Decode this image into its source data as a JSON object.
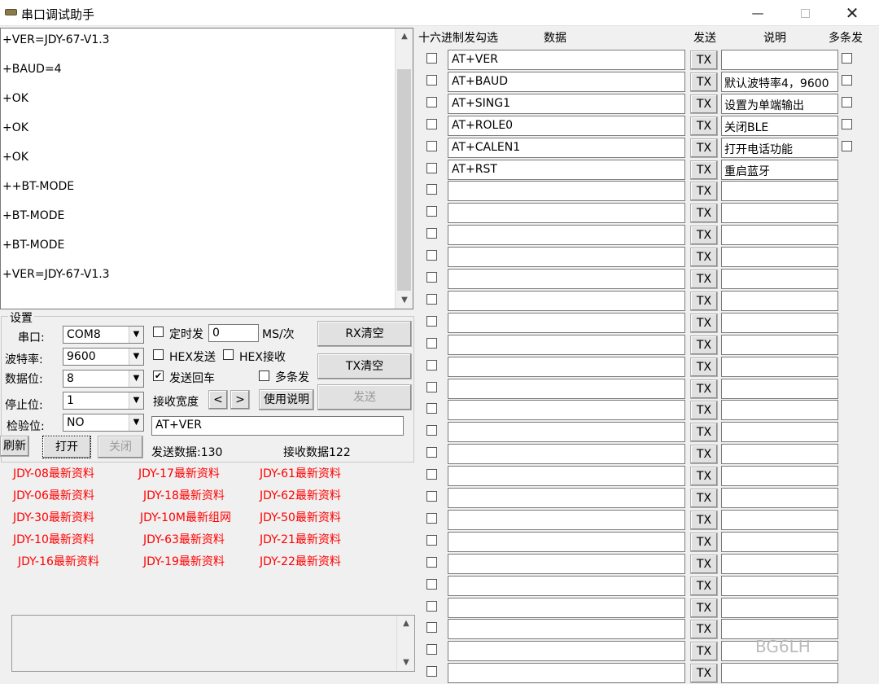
{
  "window": {
    "title": "串口调试助手",
    "minimize": "—",
    "close": "✕"
  },
  "receive": {
    "lines": [
      "+VER=JDY-67-V1.3",
      "+BAUD=4",
      "+OK",
      "+OK",
      "+OK",
      "++BT-MODE",
      "+BT-MODE",
      "+BT-MODE",
      "+VER=JDY-67-V1.3"
    ],
    "scroll_up": "▲",
    "scroll_down": "▼"
  },
  "settings": {
    "group_title": "设置",
    "port_label": "串口:",
    "port_value": "COM8",
    "baud_label": "波特率:",
    "baud_value": "9600",
    "databits_label": "数据位:",
    "databits_value": "8",
    "stopbits_label": "停止位:",
    "stopbits_value": "1",
    "parity_label": "检验位:",
    "parity_value": "NO",
    "timed_send_label": "定时发",
    "timed_send_value": "0",
    "timed_send_unit": "MS/次",
    "hex_send_label": "HEX发送",
    "hex_recv_label": "HEX接收",
    "send_cr_label": "发送回车",
    "send_cr_mark": "✔",
    "multi_send_label": "多条发",
    "recv_width_label": "接收宽度",
    "narrow": "<",
    "widen": ">",
    "help_button": "使用说明",
    "rx_clear": "RX清空",
    "tx_clear": "TX清空",
    "send_button": "发送",
    "send_input": "AT+VER",
    "refresh": "刷新",
    "open": "打开",
    "close": "关闭",
    "sent_stats": "发送数据:130",
    "recv_stats": "接收数据122",
    "drop": "▼"
  },
  "links": [
    [
      "JDY-08最新资料",
      "JDY-17最新资料",
      "JDY-61最新资料"
    ],
    [
      "JDY-06最新资料",
      "JDY-18最新资料",
      "JDY-62最新资料"
    ],
    [
      "JDY-30最新资料",
      "JDY-10M最新组网",
      "JDY-50最新资料"
    ],
    [
      "JDY-10最新资料",
      "JDY-63最新资料",
      "JDY-21最新资料"
    ],
    [
      "JDY-16最新资料",
      "JDY-19最新资料",
      "JDY-22最新资料"
    ]
  ],
  "multi": {
    "header": {
      "hex": "十六进制发勾选",
      "data": "数据",
      "send": "发送",
      "note": "说明",
      "multi": "多条发"
    },
    "tx_label": "TX",
    "rows": [
      {
        "data": "AT+VER",
        "note": "",
        "multi": true
      },
      {
        "data": "AT+BAUD",
        "note": "默认波特率4，9600",
        "multi": true
      },
      {
        "data": "AT+SING1",
        "note": "设置为单端输出",
        "multi": true
      },
      {
        "data": "AT+ROLE0",
        "note": "关闭BLE",
        "multi": true
      },
      {
        "data": "AT+CALEN1",
        "note": "打开电话功能",
        "multi": true
      },
      {
        "data": "AT+RST",
        "note": "重启蓝牙",
        "multi": false
      },
      {
        "data": "",
        "note": "",
        "multi": false
      },
      {
        "data": "",
        "note": "",
        "multi": false
      },
      {
        "data": "",
        "note": "",
        "multi": false
      },
      {
        "data": "",
        "note": "",
        "multi": false
      },
      {
        "data": "",
        "note": "",
        "multi": false
      },
      {
        "data": "",
        "note": "",
        "multi": false
      },
      {
        "data": "",
        "note": "",
        "multi": false
      },
      {
        "data": "",
        "note": "",
        "multi": false
      },
      {
        "data": "",
        "note": "",
        "multi": false
      },
      {
        "data": "",
        "note": "",
        "multi": false
      },
      {
        "data": "",
        "note": "",
        "multi": false
      },
      {
        "data": "",
        "note": "",
        "multi": false
      },
      {
        "data": "",
        "note": "",
        "multi": false
      },
      {
        "data": "",
        "note": "",
        "multi": false
      },
      {
        "data": "",
        "note": "",
        "multi": false
      },
      {
        "data": "",
        "note": "",
        "multi": false
      },
      {
        "data": "",
        "note": "",
        "multi": false
      },
      {
        "data": "",
        "note": "",
        "multi": false
      },
      {
        "data": "",
        "note": "",
        "multi": false
      },
      {
        "data": "",
        "note": "",
        "multi": false
      },
      {
        "data": "",
        "note": "",
        "multi": false
      },
      {
        "data": "",
        "note": "",
        "multi": false
      },
      {
        "data": "",
        "note": "",
        "multi": false
      },
      {
        "data": "",
        "note": "",
        "multi": false
      }
    ]
  },
  "watermark": "BG6LH"
}
